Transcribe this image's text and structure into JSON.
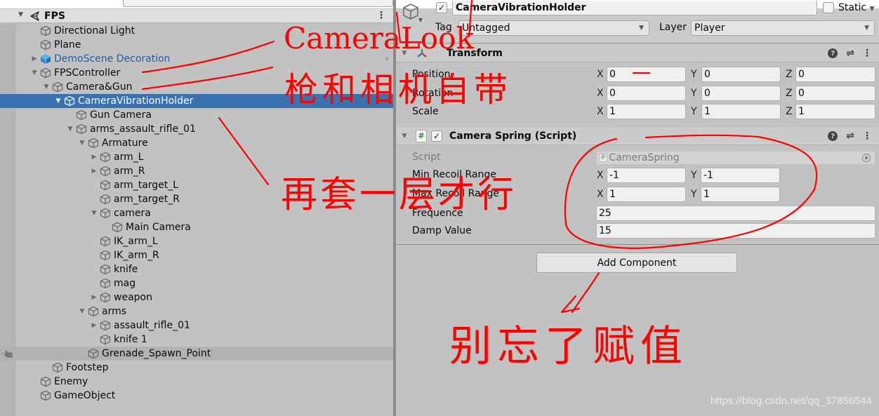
{
  "hierarchy": {
    "scene_name": "FPS",
    "items": [
      {
        "label": "Directional Light",
        "depth": 0,
        "fold": "none",
        "icon": "gameobject-icon"
      },
      {
        "label": "Plane",
        "depth": 0,
        "fold": "none",
        "icon": "gameobject-icon"
      },
      {
        "label": "DemoScene Decoration",
        "depth": 0,
        "fold": "collapsed",
        "icon": "prefab-icon",
        "prefab": true
      },
      {
        "label": "FPSController",
        "depth": 0,
        "fold": "expanded",
        "icon": "gameobject-icon"
      },
      {
        "label": "Camera&Gun",
        "depth": 1,
        "fold": "expanded",
        "icon": "gameobject-icon"
      },
      {
        "label": "CameraVibrationHolder",
        "depth": 2,
        "fold": "expanded",
        "icon": "gameobject-icon",
        "selected": true
      },
      {
        "label": "Gun Camera",
        "depth": 3,
        "fold": "none",
        "icon": "gameobject-icon"
      },
      {
        "label": "arms_assault_rifle_01",
        "depth": 3,
        "fold": "expanded",
        "icon": "gameobject-icon"
      },
      {
        "label": "Armature",
        "depth": 4,
        "fold": "expanded",
        "icon": "gameobject-icon"
      },
      {
        "label": "arm_L",
        "depth": 5,
        "fold": "collapsed",
        "icon": "gameobject-icon"
      },
      {
        "label": "arm_R",
        "depth": 5,
        "fold": "collapsed",
        "icon": "gameobject-icon"
      },
      {
        "label": "arm_target_L",
        "depth": 5,
        "fold": "none",
        "icon": "gameobject-icon"
      },
      {
        "label": "arm_target_R",
        "depth": 5,
        "fold": "none",
        "icon": "gameobject-icon"
      },
      {
        "label": "camera",
        "depth": 5,
        "fold": "expanded",
        "icon": "gameobject-icon"
      },
      {
        "label": "Main Camera",
        "depth": 6,
        "fold": "none",
        "icon": "gameobject-icon"
      },
      {
        "label": "IK_arm_L",
        "depth": 5,
        "fold": "none",
        "icon": "gameobject-icon"
      },
      {
        "label": "IK_arm_R",
        "depth": 5,
        "fold": "none",
        "icon": "gameobject-icon"
      },
      {
        "label": "knife",
        "depth": 5,
        "fold": "none",
        "icon": "gameobject-icon"
      },
      {
        "label": "mag",
        "depth": 5,
        "fold": "none",
        "icon": "gameobject-icon"
      },
      {
        "label": "weapon",
        "depth": 5,
        "fold": "collapsed",
        "icon": "gameobject-icon"
      },
      {
        "label": "arms",
        "depth": 4,
        "fold": "expanded",
        "icon": "gameobject-icon"
      },
      {
        "label": "assault_rifle_01",
        "depth": 5,
        "fold": "collapsed",
        "icon": "gameobject-icon"
      },
      {
        "label": "knife 1",
        "depth": 5,
        "fold": "none",
        "icon": "gameobject-icon"
      },
      {
        "label": "Grenade_Spawn_Point",
        "depth": 4,
        "fold": "none",
        "icon": "gameobject-icon",
        "hover": true
      },
      {
        "label": "Footstep",
        "depth": 1,
        "fold": "none",
        "icon": "gameobject-icon"
      },
      {
        "label": "Enemy",
        "depth": 0,
        "fold": "none",
        "icon": "gameobject-icon"
      },
      {
        "label": "GameObject",
        "depth": 0,
        "fold": "none",
        "icon": "gameobject-icon"
      }
    ]
  },
  "inspector": {
    "gameobject": {
      "active": true,
      "name": "CameraVibrationHolder",
      "static_label": "Static",
      "static_checked": false,
      "tag_label": "Tag",
      "tag_value": "Untagged",
      "layer_label": "Layer",
      "layer_value": "Player"
    },
    "transform": {
      "title": "Transform",
      "rows": [
        {
          "label": "Position",
          "x": "0",
          "y": "0",
          "z": "0"
        },
        {
          "label": "Rotation",
          "x": "0",
          "y": "0",
          "z": "0"
        },
        {
          "label": "Scale",
          "x": "1",
          "y": "1",
          "z": "1"
        }
      ],
      "axis_labels": {
        "x": "X",
        "y": "Y",
        "z": "Z"
      }
    },
    "camera_spring": {
      "title": "Camera Spring (Script)",
      "enabled": true,
      "script_label": "Script",
      "script_value": "CameraSpring",
      "min_recoil": {
        "label": "Min Recoil Range",
        "x": "-1",
        "y": "-1"
      },
      "max_recoil": {
        "label": "Max Recoil Range",
        "x": "1",
        "y": "1"
      },
      "frequence": {
        "label": "Frequence",
        "value": "25"
      },
      "damp": {
        "label": "Damp Value",
        "value": "15"
      }
    },
    "add_component_label": "Add Component"
  },
  "annotations": {
    "camera_look": "CameraLook",
    "gun_camera_note": "枪和相机自带",
    "wrap_note": "再套一层才行",
    "assign_note": "别忘了赋值",
    "color": "#ff0000"
  },
  "watermark": "https://blog.csdn.net/qq_37856544"
}
